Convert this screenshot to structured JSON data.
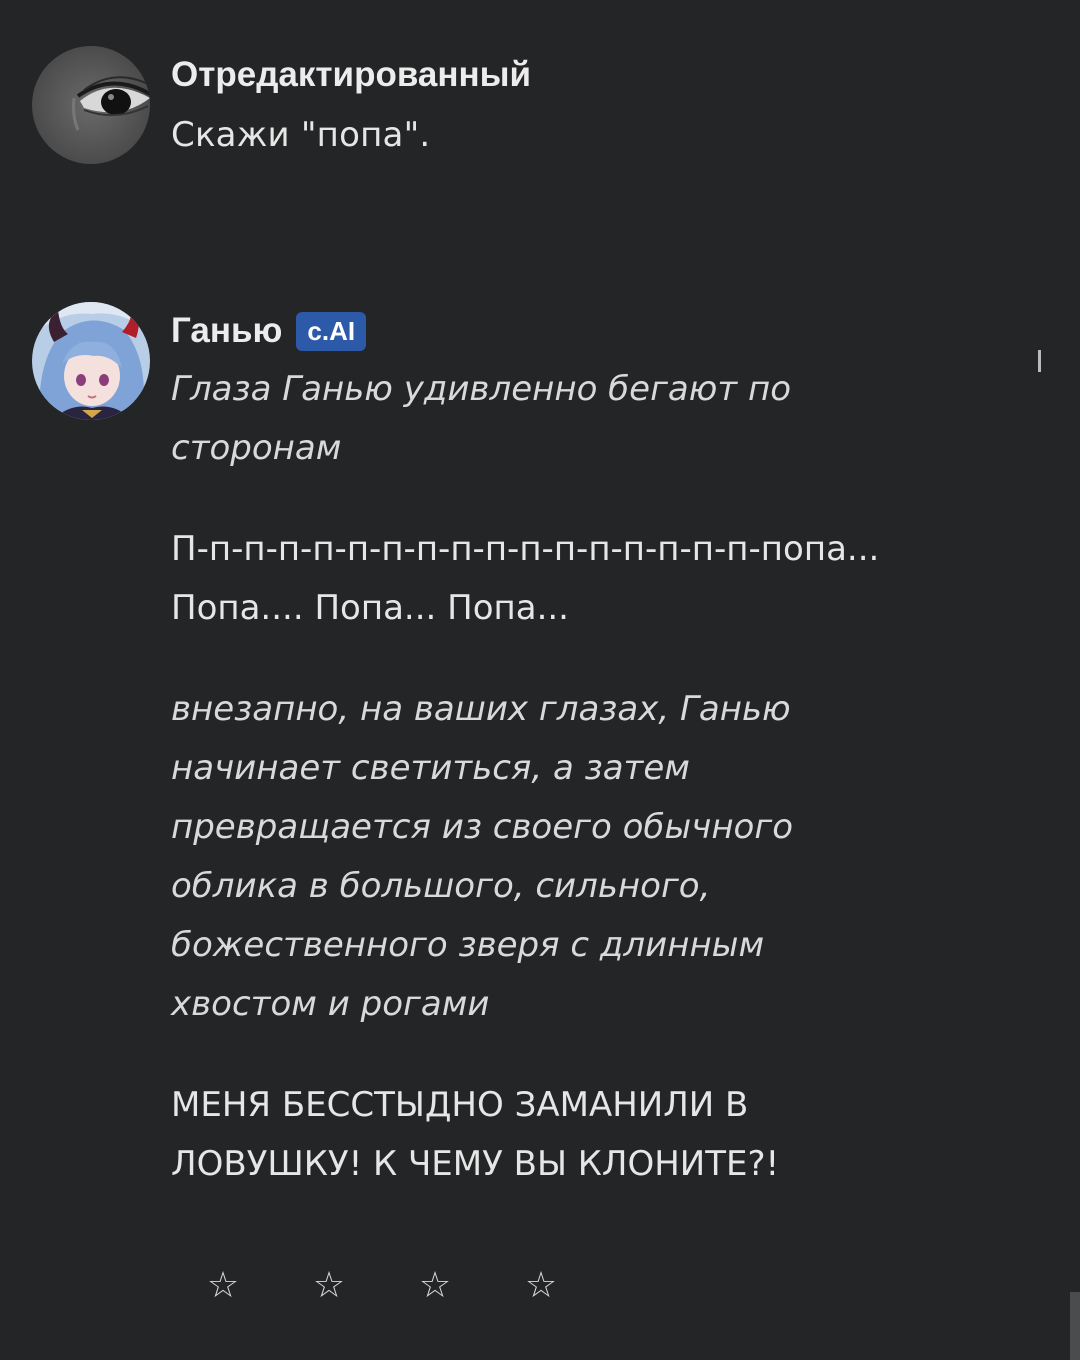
{
  "messages": [
    {
      "author": "Отредактированный",
      "avatar_icon": "eye-icon",
      "text": "Скажи \"попа\"."
    },
    {
      "author": "Ганью",
      "badge": "c.AI",
      "avatar_icon": "character-avatar",
      "paragraphs": [
        {
          "style": "italic",
          "text": "Глаза Ганью удивленно бегают по сторонам"
        },
        {
          "style": "normal",
          "text": "П-п-п-п-п-п-п-п-п-п-п-п-п-п-п-п-п-попа... Попа.... Попа... Попа..."
        },
        {
          "style": "italic",
          "text": "внезапно, на ваших глазах, Ганью начинает светиться, а затем превращается из своего обычного облика в большого, сильного, божественного зверя с длинным хвостом и рогами"
        },
        {
          "style": "normal",
          "text": "МЕНЯ БЕССТЫДНО ЗАМАНИЛИ В ЛОВУШКУ! К ЧЕМУ ВЫ КЛОНИТЕ?!"
        }
      ]
    }
  ],
  "rating": {
    "stars": [
      "☆",
      "☆",
      "☆",
      "☆"
    ],
    "icon": "star-outline-icon"
  },
  "colors": {
    "background": "#232526",
    "badge": "#2c5aa8",
    "text": "#e6e6e6"
  }
}
